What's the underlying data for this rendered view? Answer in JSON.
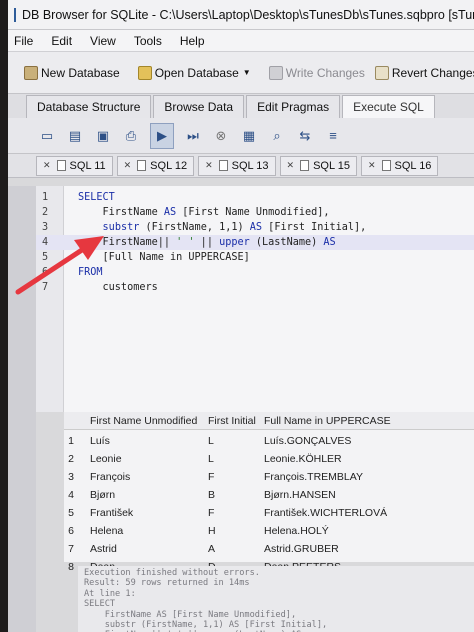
{
  "window": {
    "title": "DB Browser for SQLite - C:\\Users\\Laptop\\Desktop\\sTunesDb\\sTunes.sqbpro [sTunes.db]"
  },
  "menu": [
    "File",
    "Edit",
    "View",
    "Tools",
    "Help"
  ],
  "toolbar": {
    "new_database": "New Database",
    "open_database": "Open Database",
    "write_changes": "Write Changes",
    "revert_changes": "Revert Changes"
  },
  "tabs": [
    "Database Structure",
    "Browse Data",
    "Edit Pragmas",
    "Execute SQL"
  ],
  "sql_tabs": [
    "SQL 11",
    "SQL 12",
    "SQL 13",
    "SQL 15",
    "SQL 16"
  ],
  "editor": {
    "lines": [
      {
        "n": "1",
        "parts": [
          [
            "kw",
            "SELECT"
          ]
        ]
      },
      {
        "n": "2",
        "parts": [
          [
            "",
            "    FirstName "
          ],
          [
            "kw",
            "AS"
          ],
          [
            "",
            " [First Name Unmodified],"
          ]
        ]
      },
      {
        "n": "3",
        "parts": [
          [
            "",
            "    "
          ],
          [
            "kw",
            "substr"
          ],
          [
            "",
            " (FirstName, 1,1) "
          ],
          [
            "kw",
            "AS"
          ],
          [
            "",
            " [First Initial],"
          ]
        ]
      },
      {
        "n": "4",
        "parts": [
          [
            "",
            "    FirstName|| "
          ],
          [
            "str",
            "' '"
          ],
          [
            "",
            " || "
          ],
          [
            "kw",
            "upper"
          ],
          [
            "",
            " (LastName) "
          ],
          [
            "kw",
            "AS"
          ]
        ]
      },
      {
        "n": "5",
        "parts": [
          [
            "",
            "    [Full Name in UPPERCASE]"
          ]
        ]
      },
      {
        "n": "6",
        "parts": [
          [
            "kw",
            "FROM"
          ]
        ]
      },
      {
        "n": "7",
        "parts": [
          [
            "",
            "    customers"
          ]
        ]
      }
    ]
  },
  "results": {
    "columns": [
      "First Name Unmodified",
      "First Initial",
      "Full Name in UPPERCASE"
    ],
    "rows": [
      [
        "1",
        "Luís",
        "L",
        "Luís.GONÇALVES"
      ],
      [
        "2",
        "Leonie",
        "L",
        "Leonie.KÖHLER"
      ],
      [
        "3",
        "François",
        "F",
        "François.TREMBLAY"
      ],
      [
        "4",
        "Bjørn",
        "B",
        "Bjørn.HANSEN"
      ],
      [
        "5",
        "František",
        "F",
        "František.WICHTERLOVÁ"
      ],
      [
        "6",
        "Helena",
        "H",
        "Helena.HOLÝ"
      ],
      [
        "7",
        "Astrid",
        "A",
        "Astrid.GRUBER"
      ],
      [
        "8",
        "Daan",
        "D",
        "Daan.PEETERS"
      ]
    ]
  },
  "messages": "Execution finished without errors.\nResult: 59 rows returned in 14ms\nAt line 1:\nSELECT\n    FirstName AS [First Name Unmodified],\n    substr (FirstName, 1,1) AS [First Initial],\n    FirstName|| ' ' || upper (LastName) AS"
}
